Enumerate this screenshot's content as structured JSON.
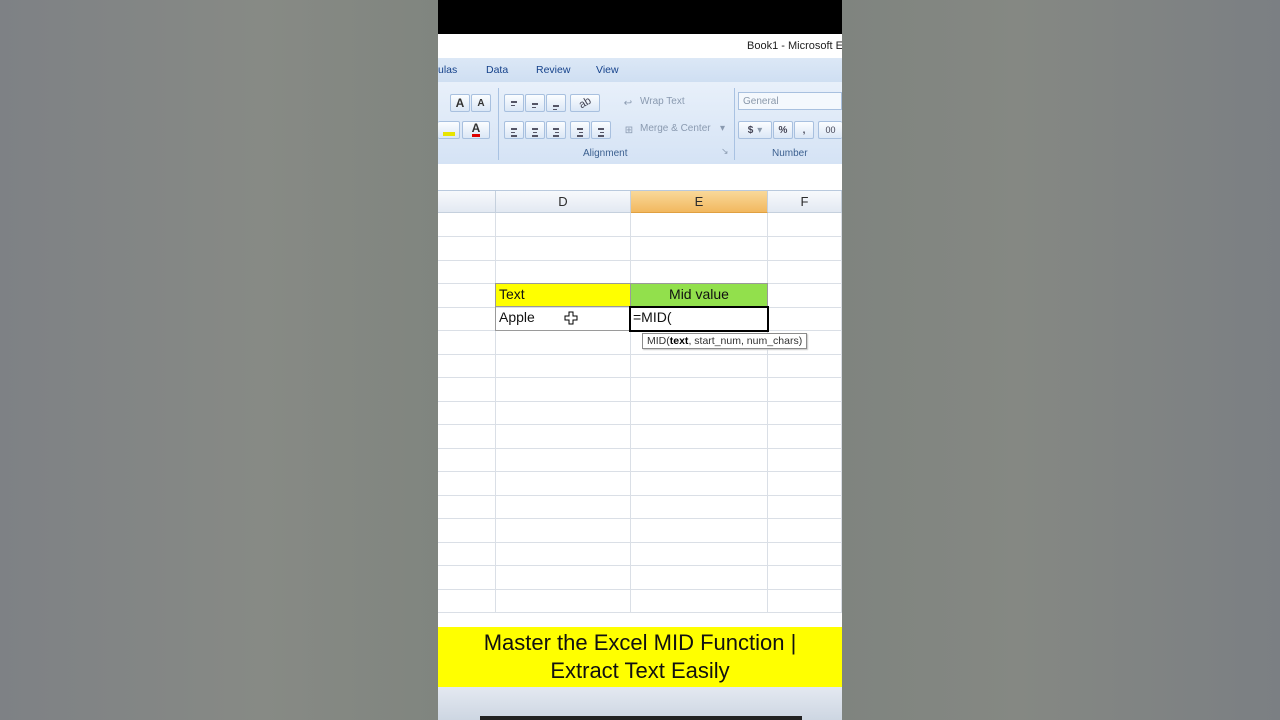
{
  "window": {
    "title": "Book1 - Microsoft E"
  },
  "ribbon_tabs": [
    "ulas",
    "Data",
    "Review",
    "View"
  ],
  "ribbon": {
    "font_grow": "A",
    "font_shrink": "A",
    "wrap_text": "Wrap Text",
    "merge_center": "Merge & Center",
    "number_format": "General",
    "currency": "$",
    "percent": "%",
    "comma": ",",
    "decimals": "00",
    "group_alignment": "Alignment",
    "group_number": "Number"
  },
  "columns": [
    "D",
    "E",
    "F"
  ],
  "selected_column": "E",
  "cells": {
    "d_header": "Text",
    "e_header": "Mid value",
    "d_value": "Apple",
    "e_formula": "=MID("
  },
  "tooltip": {
    "func": "MID(",
    "arg_bold": "text",
    "rest": ", start_num, num_chars)"
  },
  "caption": {
    "line1": "Master the Excel MID Function |",
    "line2": "Extract Text Easily"
  },
  "colors": {
    "header_text_fill": "#ffff00",
    "header_mid_fill": "#92e04c",
    "caption_bg": "#ffff00",
    "selected_col_header": "#f2b85f"
  }
}
